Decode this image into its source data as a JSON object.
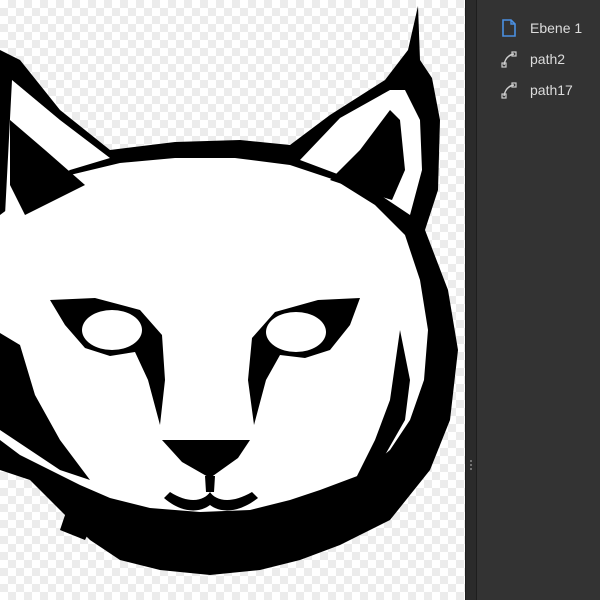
{
  "layers_panel": {
    "items": [
      {
        "label": "Ebene 1",
        "icon": "layer-document-icon"
      },
      {
        "label": "path2",
        "icon": "path-node-icon"
      },
      {
        "label": "path17",
        "icon": "path-node-icon"
      }
    ]
  },
  "colors": {
    "panel_bg": "#333333",
    "splitter_bg": "#2b2b2b",
    "text": "#dcdcdc",
    "layer_icon": "#4a90e2",
    "artwork": "#000000"
  }
}
